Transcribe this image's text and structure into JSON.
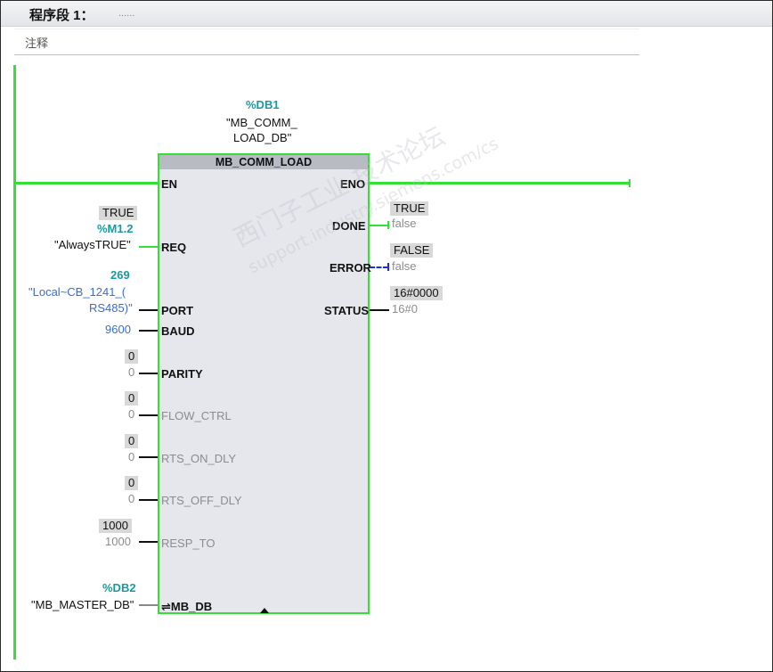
{
  "network": {
    "title": "程序段 1：",
    "dots": "......",
    "comment": "注释"
  },
  "block": {
    "instance_addr": "%DB1",
    "instance_name_1": "\"MB_COMM_",
    "instance_name_2": "LOAD_DB\"",
    "type": "MB_COMM_LOAD"
  },
  "inputs": {
    "en": "EN",
    "req": {
      "pin": "REQ",
      "monitor": "TRUE",
      "addr": "%M1.2",
      "tag": "\"AlwaysTRUE\""
    },
    "port": {
      "pin": "PORT",
      "const": "269",
      "tag_1": "\"Local~CB_1241_(",
      "tag_2": "RS485)\""
    },
    "baud": {
      "pin": "BAUD",
      "value": "9600"
    },
    "parity": {
      "pin": "PARITY",
      "monitor": "0",
      "value": "0"
    },
    "flow_ctrl": {
      "pin": "FLOW_CTRL",
      "monitor": "0",
      "value": "0"
    },
    "rts_on_dly": {
      "pin": "RTS_ON_DLY",
      "monitor": "0",
      "value": "0"
    },
    "rts_off_dly": {
      "pin": "RTS_OFF_DLY",
      "monitor": "0",
      "value": "0"
    },
    "resp_to": {
      "pin": "RESP_TO",
      "monitor": "1000",
      "value": "1000"
    },
    "mb_db": {
      "pin": "⇌MB_DB",
      "addr": "%DB2",
      "tag": "\"MB_MASTER_DB\""
    }
  },
  "outputs": {
    "eno": "ENO",
    "done": {
      "pin": "DONE",
      "monitor": "TRUE",
      "value": "false"
    },
    "error": {
      "pin": "ERROR",
      "monitor": "FALSE",
      "value": "false"
    },
    "status": {
      "pin": "STATUS",
      "monitor": "16#0000",
      "value": "16#0"
    }
  },
  "watermark": {
    "line1": "西门子工业 技术论坛",
    "line2": "support.industry.siemens.com/cs"
  },
  "colors": {
    "wire_active": "#33e033",
    "address": "#1a9aa0",
    "constant": "#3a6ed0",
    "box": "#e6e7ec"
  }
}
